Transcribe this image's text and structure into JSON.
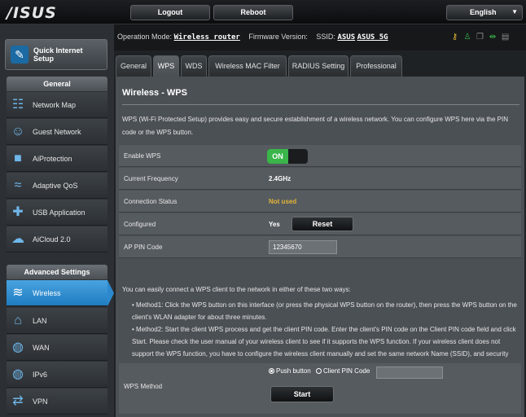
{
  "header": {
    "logo": "/ISUS",
    "logout": "Logout",
    "reboot": "Reboot",
    "language": "English"
  },
  "status": {
    "op_mode_label": "Operation Mode:",
    "op_mode_value": "Wireless router",
    "fw_label": "Firmware Version:",
    "ssid_label": "SSID:",
    "ssid_1": "ASUS",
    "ssid_2": "ASUS_5G"
  },
  "sidebar": {
    "qis_label_1": "Quick Internet",
    "qis_label_2": "Setup",
    "general_header": "General",
    "general_items": [
      {
        "label": "Network Map"
      },
      {
        "label": "Guest Network"
      },
      {
        "label": "AiProtection"
      },
      {
        "label": "Adaptive QoS"
      },
      {
        "label": "USB Application"
      },
      {
        "label": "AiCloud 2.0"
      }
    ],
    "advanced_header": "Advanced Settings",
    "advanced_items": [
      {
        "label": "Wireless"
      },
      {
        "label": "LAN"
      },
      {
        "label": "WAN"
      },
      {
        "label": "IPv6"
      },
      {
        "label": "VPN"
      }
    ]
  },
  "tabs": [
    {
      "label": "General"
    },
    {
      "label": "WPS"
    },
    {
      "label": "WDS"
    },
    {
      "label": "Wireless MAC Filter"
    },
    {
      "label": "RADIUS Setting"
    },
    {
      "label": "Professional"
    }
  ],
  "panel": {
    "title": "Wireless - WPS",
    "description": "WPS (Wi-Fi Protected Setup) provides easy and secure establishment of a wireless network. You can configure WPS here via the PIN code or the WPS button.",
    "rows": {
      "enable_wps": {
        "label": "Enable WPS",
        "value": "ON"
      },
      "frequency": {
        "label": "Current Frequency",
        "value": "2.4GHz"
      },
      "connection": {
        "label": "Connection Status",
        "value": "Not used"
      },
      "configured": {
        "label": "Configured",
        "value": "Yes",
        "button": "Reset"
      },
      "ap_pin": {
        "label": "AP PIN Code",
        "value": "12345670"
      }
    },
    "info_intro": "You can easily connect a WPS client to the network in either of these two ways:",
    "method1": "• Method1: Click the WPS button on this interface (or press the physical WPS button on the router), then press the WPS button on the client's WLAN adapter for about three minutes.",
    "method2": "• Method2: Start the client WPS process and get the client PIN code. Enter the client's PIN code on the Client PIN code field and click Start. Please check the user manual of your wireless client to see if it supports the WPS function. If your wireless client does not support the WPS function, you have to configure the wireless client manually and set the same network Name (SSID), and security settings as this router.",
    "wps_method": {
      "label": "WPS Method",
      "opt_push": "Push button",
      "opt_pin": "Client PIN Code",
      "start": "Start"
    }
  },
  "colors": {
    "accent": "#1f7cc0",
    "on_green": "#3ab54a",
    "status_amber": "#e2b437"
  }
}
